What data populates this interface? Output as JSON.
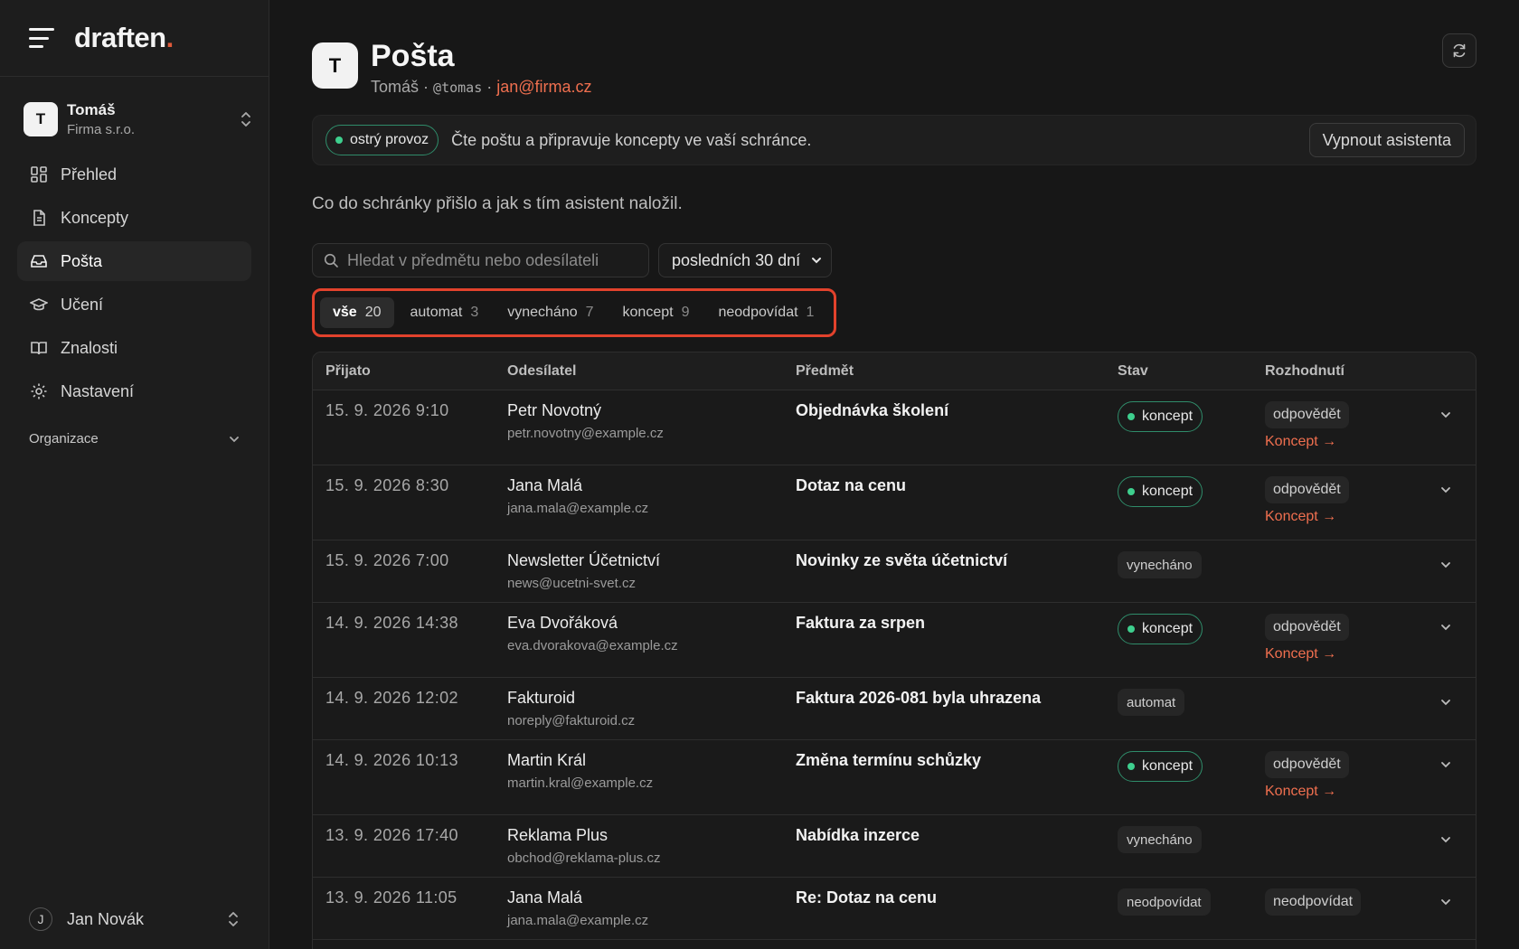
{
  "brand": {
    "name": "draften",
    "dot": "."
  },
  "org": {
    "avatar": "T",
    "name": "Tomáš",
    "company": "Firma s.r.o."
  },
  "nav": {
    "items": [
      {
        "label": "Přehled",
        "icon": "dashboard-icon"
      },
      {
        "label": "Koncepty",
        "icon": "document-icon"
      },
      {
        "label": "Pošta",
        "icon": "inbox-icon",
        "active": true
      },
      {
        "label": "Učení",
        "icon": "graduation-cap-icon"
      },
      {
        "label": "Znalosti",
        "icon": "book-icon"
      },
      {
        "label": "Nastavení",
        "icon": "gear-icon"
      }
    ],
    "section": "Organizace"
  },
  "user": {
    "avatar": "J",
    "name": "Jan Novák"
  },
  "header": {
    "avatar": "T",
    "title": "Pošta",
    "name": "Tomáš",
    "separator": "·",
    "handle": "@tomas",
    "email": "jan@firma.cz"
  },
  "banner": {
    "status": "ostrý provoz",
    "text": "Čte poštu a připravuje koncepty ve vaší schránce.",
    "button": "Vypnout asistenta"
  },
  "description": "Co do schránky přišlo a jak s tím asistent naložil.",
  "search": {
    "placeholder": "Hledat v předmětu nebo odesílateli"
  },
  "period": {
    "selected": "posledních 30 dní"
  },
  "tabs": [
    {
      "label": "vše",
      "count": "20",
      "active": true
    },
    {
      "label": "automat",
      "count": "3"
    },
    {
      "label": "vynecháno",
      "count": "7"
    },
    {
      "label": "koncept",
      "count": "9"
    },
    {
      "label": "neodpovídat",
      "count": "1"
    }
  ],
  "table": {
    "headers": [
      "Přijato",
      "Odesílatel",
      "Předmět",
      "Stav",
      "Rozhodnutí"
    ],
    "rows": [
      {
        "date": "15. 9. 2026 9:10",
        "sender": "Petr Novotný",
        "email": "petr.novotny@example.cz",
        "subject": "Objednávka školení",
        "status": "koncept",
        "decision": "odpovědět",
        "link": "Koncept →"
      },
      {
        "date": "15. 9. 2026 8:30",
        "sender": "Jana Malá",
        "email": "jana.mala@example.cz",
        "subject": "Dotaz na cenu",
        "status": "koncept",
        "decision": "odpovědět",
        "link": "Koncept →"
      },
      {
        "date": "15. 9. 2026 7:00",
        "sender": "Newsletter Účetnictví",
        "email": "news@ucetni-svet.cz",
        "subject": "Novinky ze světa účetnictví",
        "status": "vynecháno",
        "decision": "",
        "link": ""
      },
      {
        "date": "14. 9. 2026 14:38",
        "sender": "Eva Dvořáková",
        "email": "eva.dvorakova@example.cz",
        "subject": "Faktura za srpen",
        "status": "koncept",
        "decision": "odpovědět",
        "link": "Koncept →"
      },
      {
        "date": "14. 9. 2026 12:02",
        "sender": "Fakturoid",
        "email": "noreply@fakturoid.cz",
        "subject": "Faktura 2026-081 byla uhrazena",
        "status": "automat",
        "decision": "",
        "link": ""
      },
      {
        "date": "14. 9. 2026 10:13",
        "sender": "Martin Král",
        "email": "martin.kral@example.cz",
        "subject": "Změna termínu schůzky",
        "status": "koncept",
        "decision": "odpovědět",
        "link": "Koncept →"
      },
      {
        "date": "13. 9. 2026 17:40",
        "sender": "Reklama Plus",
        "email": "obchod@reklama-plus.cz",
        "subject": "Nabídka inzerce",
        "status": "vynecháno",
        "decision": "",
        "link": ""
      },
      {
        "date": "13. 9. 2026 11:05",
        "sender": "Jana Malá",
        "email": "jana.mala@example.cz",
        "subject": "Re: Dotaz na cenu",
        "status": "neodpovídat",
        "decision": "neodpovídat",
        "link": ""
      }
    ]
  },
  "colors": {
    "accent": "#ef6f4f",
    "live": "#3ecf8e",
    "highlight": "#e2422c",
    "background": "#171717"
  }
}
